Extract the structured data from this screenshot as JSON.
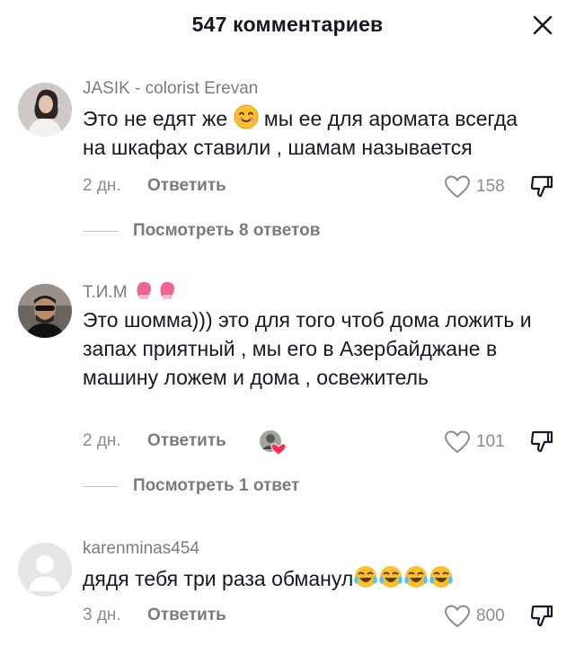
{
  "header": {
    "title": "547 комментариев"
  },
  "comments": [
    {
      "username": "JASIK - colorist Erevan",
      "text_a": "Это не едят же",
      "text_b": " мы ее для аромата всегда на шкафах ставили , шамам называется",
      "time": "2 дн.",
      "reply_label": "Ответить",
      "likes": "158",
      "view_replies": "Посмотреть 8 ответов"
    },
    {
      "username": "Т.И.М",
      "text": "Это шомма))) это для того чтоб дома ложить и запах приятный , мы его в Азербайджане в машину ложем и дома , освежитель",
      "time": "2 дн.",
      "reply_label": "Ответить",
      "likes": "101",
      "view_replies": "Посмотреть 1 ответ"
    },
    {
      "username": "karenminas454",
      "text": "дядя тебя три раза обманул",
      "time": "3 дн.",
      "reply_label": "Ответить",
      "likes": "800"
    }
  ],
  "icons": {
    "close": "close-icon",
    "heart": "heart-icon",
    "dislike": "dislike-icon",
    "smile_emoji": "smiling-face-emoji",
    "boxing_glove": "boxing-glove-emoji",
    "laughing_emoji": "tears-of-joy-emoji"
  },
  "colors": {
    "text": "#161823",
    "muted": "#8a8b91",
    "accent": "#fe2c55"
  }
}
